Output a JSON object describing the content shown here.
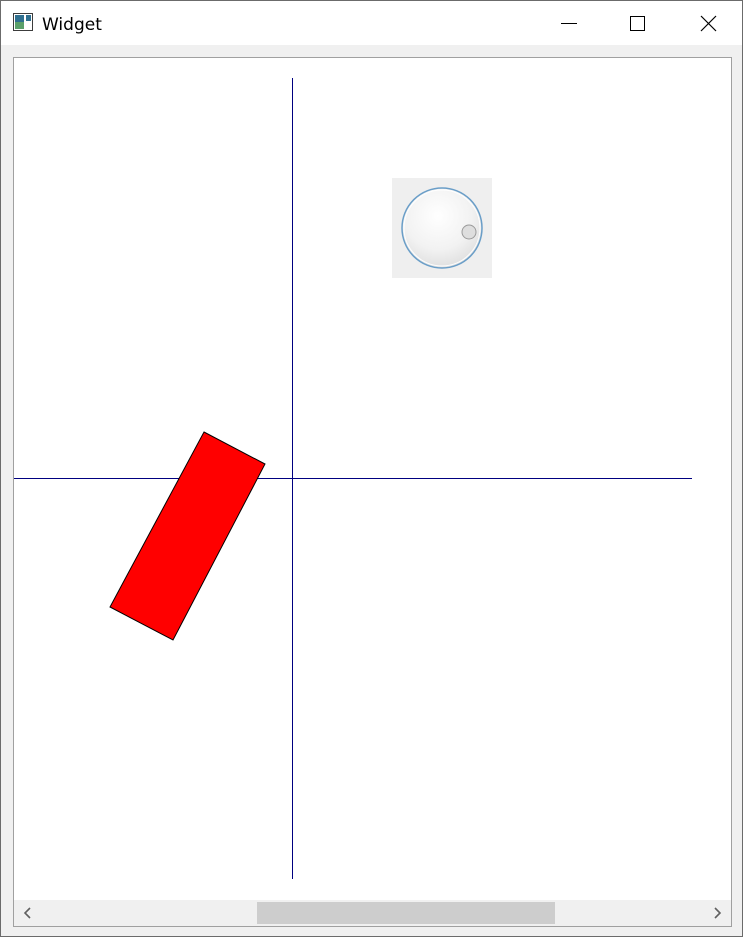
{
  "window": {
    "title": "Widget",
    "icon": "qt-app-icon",
    "controls": [
      "minimize-icon",
      "maximize-icon",
      "close-icon"
    ]
  },
  "scene": {
    "axis_color": "#000080",
    "rectangle": {
      "fill": "#ff0000",
      "stroke": "#000000"
    },
    "dial": {
      "value_angle_deg": 100,
      "icon": "rotary-dial"
    }
  },
  "scrollbar": {
    "orientation": "horizontal",
    "position_fraction": 0.5,
    "visible_fraction": 0.44,
    "left_icon": "chevron-left-icon",
    "right_icon": "chevron-right-icon"
  }
}
